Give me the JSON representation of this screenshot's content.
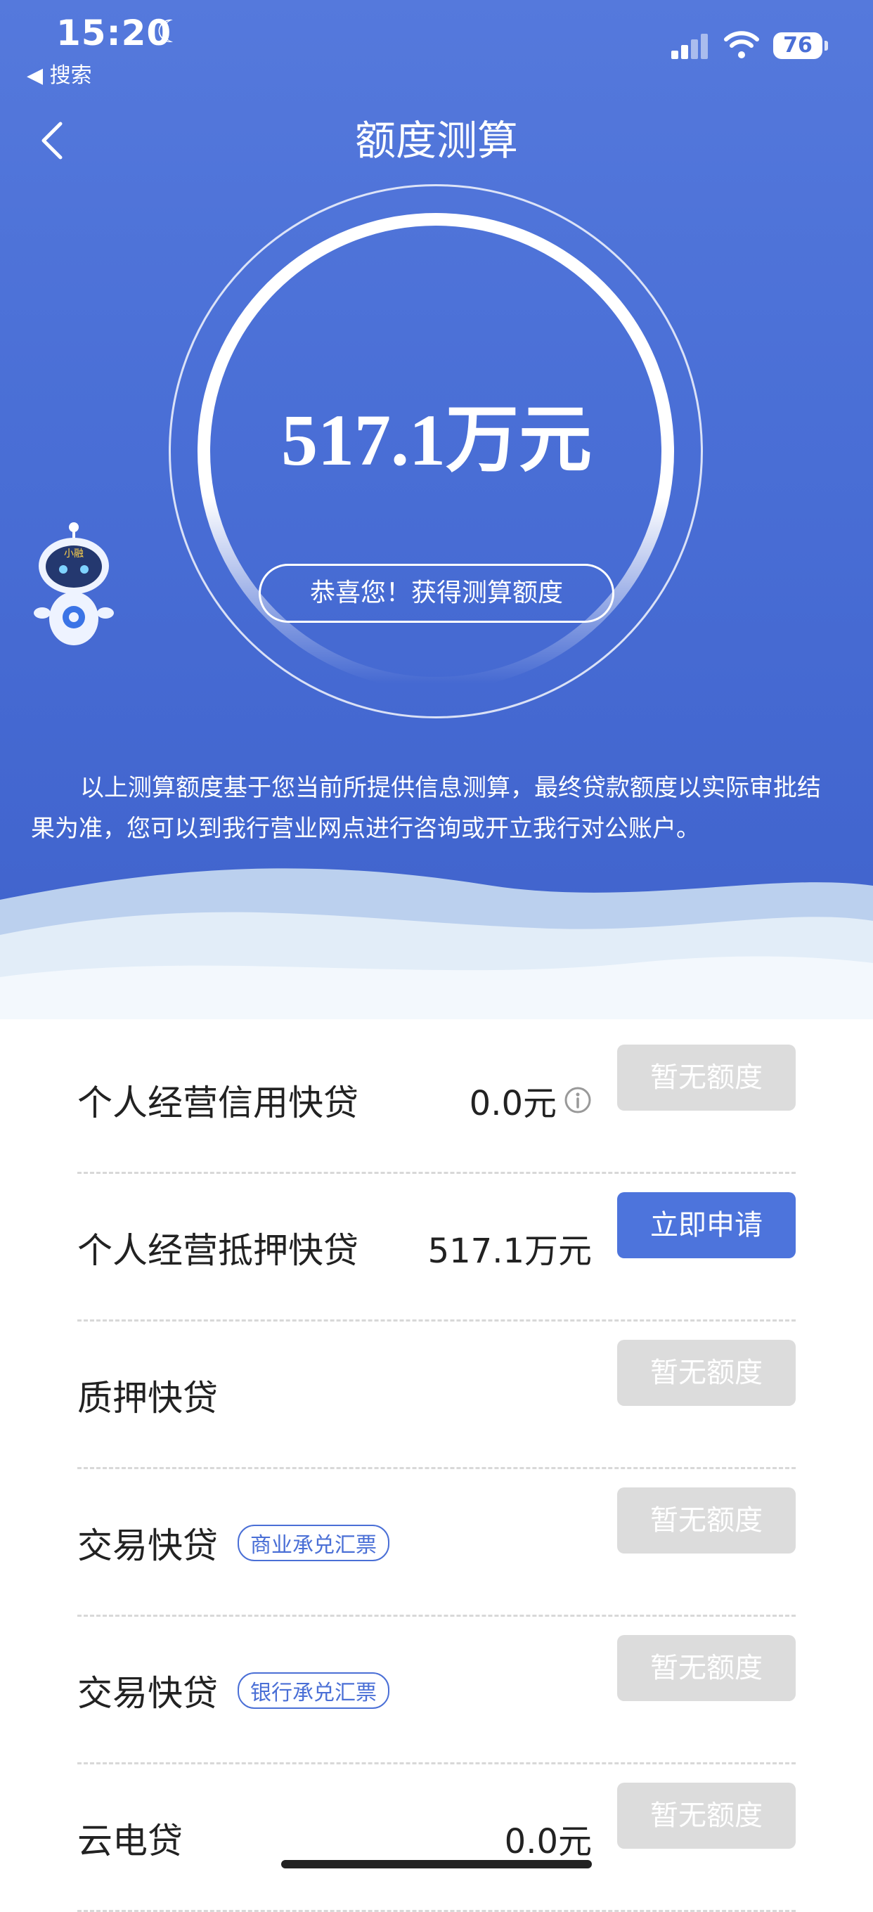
{
  "status_bar": {
    "time": "15:20",
    "back_to": "◀ 搜索",
    "battery": "76"
  },
  "header": {
    "title": "额度测算"
  },
  "result": {
    "amount": "517.1万元",
    "congrats": "恭喜您！获得测算额度"
  },
  "disclaimer": "以上测算额度基于您当前所提供信息测算，最终贷款额度以实际审批结果为准，您可以到我行营业网点进行咨询或开立我行对公账户。",
  "robot": {
    "badge": "小融"
  },
  "colors": {
    "primary": "#4a6fd6",
    "disabled": "#dcdcdc"
  },
  "products": [
    {
      "name": "个人经营信用快贷",
      "tag": "",
      "amount": "0.0元",
      "has_info": true,
      "button": "暂无额度",
      "enabled": false
    },
    {
      "name": "个人经营抵押快贷",
      "tag": "",
      "amount": "517.1万元",
      "has_info": false,
      "button": "立即申请",
      "enabled": true
    },
    {
      "name": "质押快贷",
      "tag": "",
      "amount": "",
      "has_info": false,
      "button": "暂无额度",
      "enabled": false
    },
    {
      "name": "交易快贷",
      "tag": "商业承兑汇票",
      "amount": "",
      "has_info": false,
      "button": "暂无额度",
      "enabled": false
    },
    {
      "name": "交易快贷",
      "tag": "银行承兑汇票",
      "amount": "",
      "has_info": false,
      "button": "暂无额度",
      "enabled": false
    },
    {
      "name": "云电贷",
      "tag": "",
      "amount": "0.0元",
      "has_info": false,
      "button": "暂无额度",
      "enabled": false
    }
  ]
}
